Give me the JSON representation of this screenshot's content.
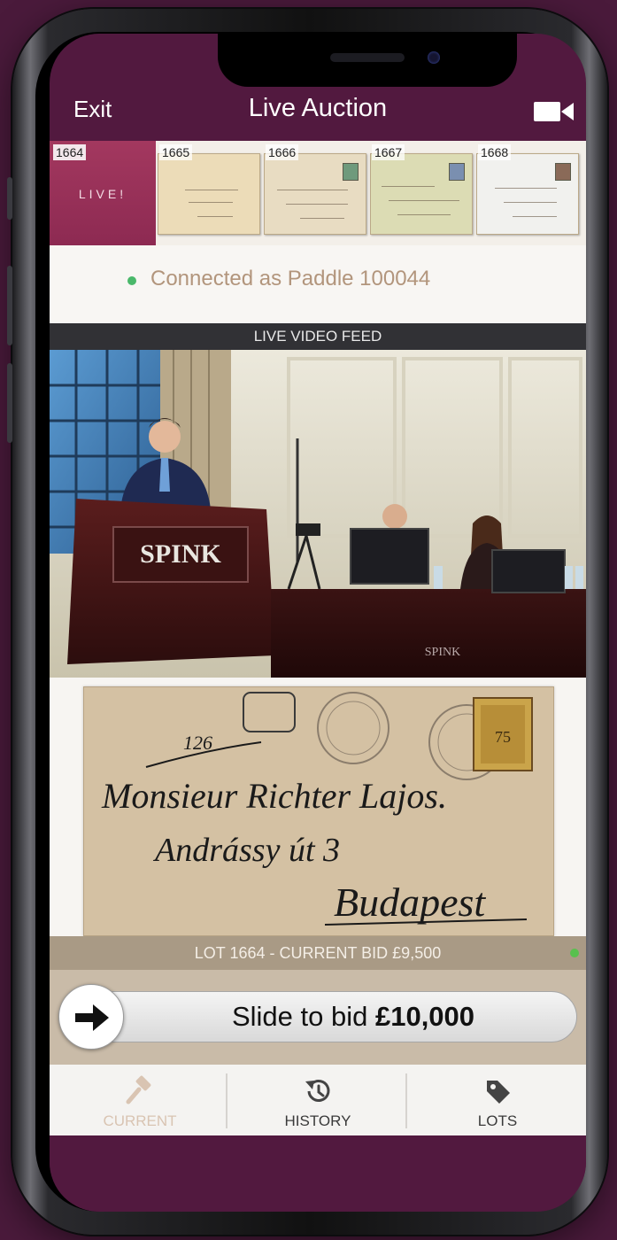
{
  "nav": {
    "exit_label": "Exit",
    "title": "Live Auction",
    "video_icon": "video-camera-icon"
  },
  "lot_strip": {
    "live_label": "LIVE!",
    "lots": [
      {
        "number": "1664",
        "live": true
      },
      {
        "number": "1665"
      },
      {
        "number": "1666"
      },
      {
        "number": "1667"
      },
      {
        "number": "1668"
      }
    ]
  },
  "status": {
    "connected_text": "Connected as Paddle 100044",
    "dot_color": "#4ab86a"
  },
  "video": {
    "header": "LIVE VIDEO FEED",
    "podium_brand": "SPINK",
    "table_brand": "SPINK"
  },
  "lot_image": {
    "address_lines": [
      "Monsieur Richter Lajos.",
      "Andrássy út 3",
      "Budapest"
    ],
    "note": "126"
  },
  "lot_bar": {
    "text": "LOT 1664 - CURRENT BID £9,500"
  },
  "slider": {
    "prefix": "Slide to bid ",
    "amount": "£10,000",
    "knob_icon": "arrow-right-icon"
  },
  "tabs": [
    {
      "label": "CURRENT",
      "icon": "gavel-icon",
      "active": true
    },
    {
      "label": "HISTORY",
      "icon": "history-icon"
    },
    {
      "label": "LOTS",
      "icon": "tag-icon"
    }
  ],
  "colors": {
    "brand": "#52193f",
    "live_tile": "#a3385f",
    "lot_bar": "#a99a85",
    "slider_bg": "#c9bba8"
  }
}
